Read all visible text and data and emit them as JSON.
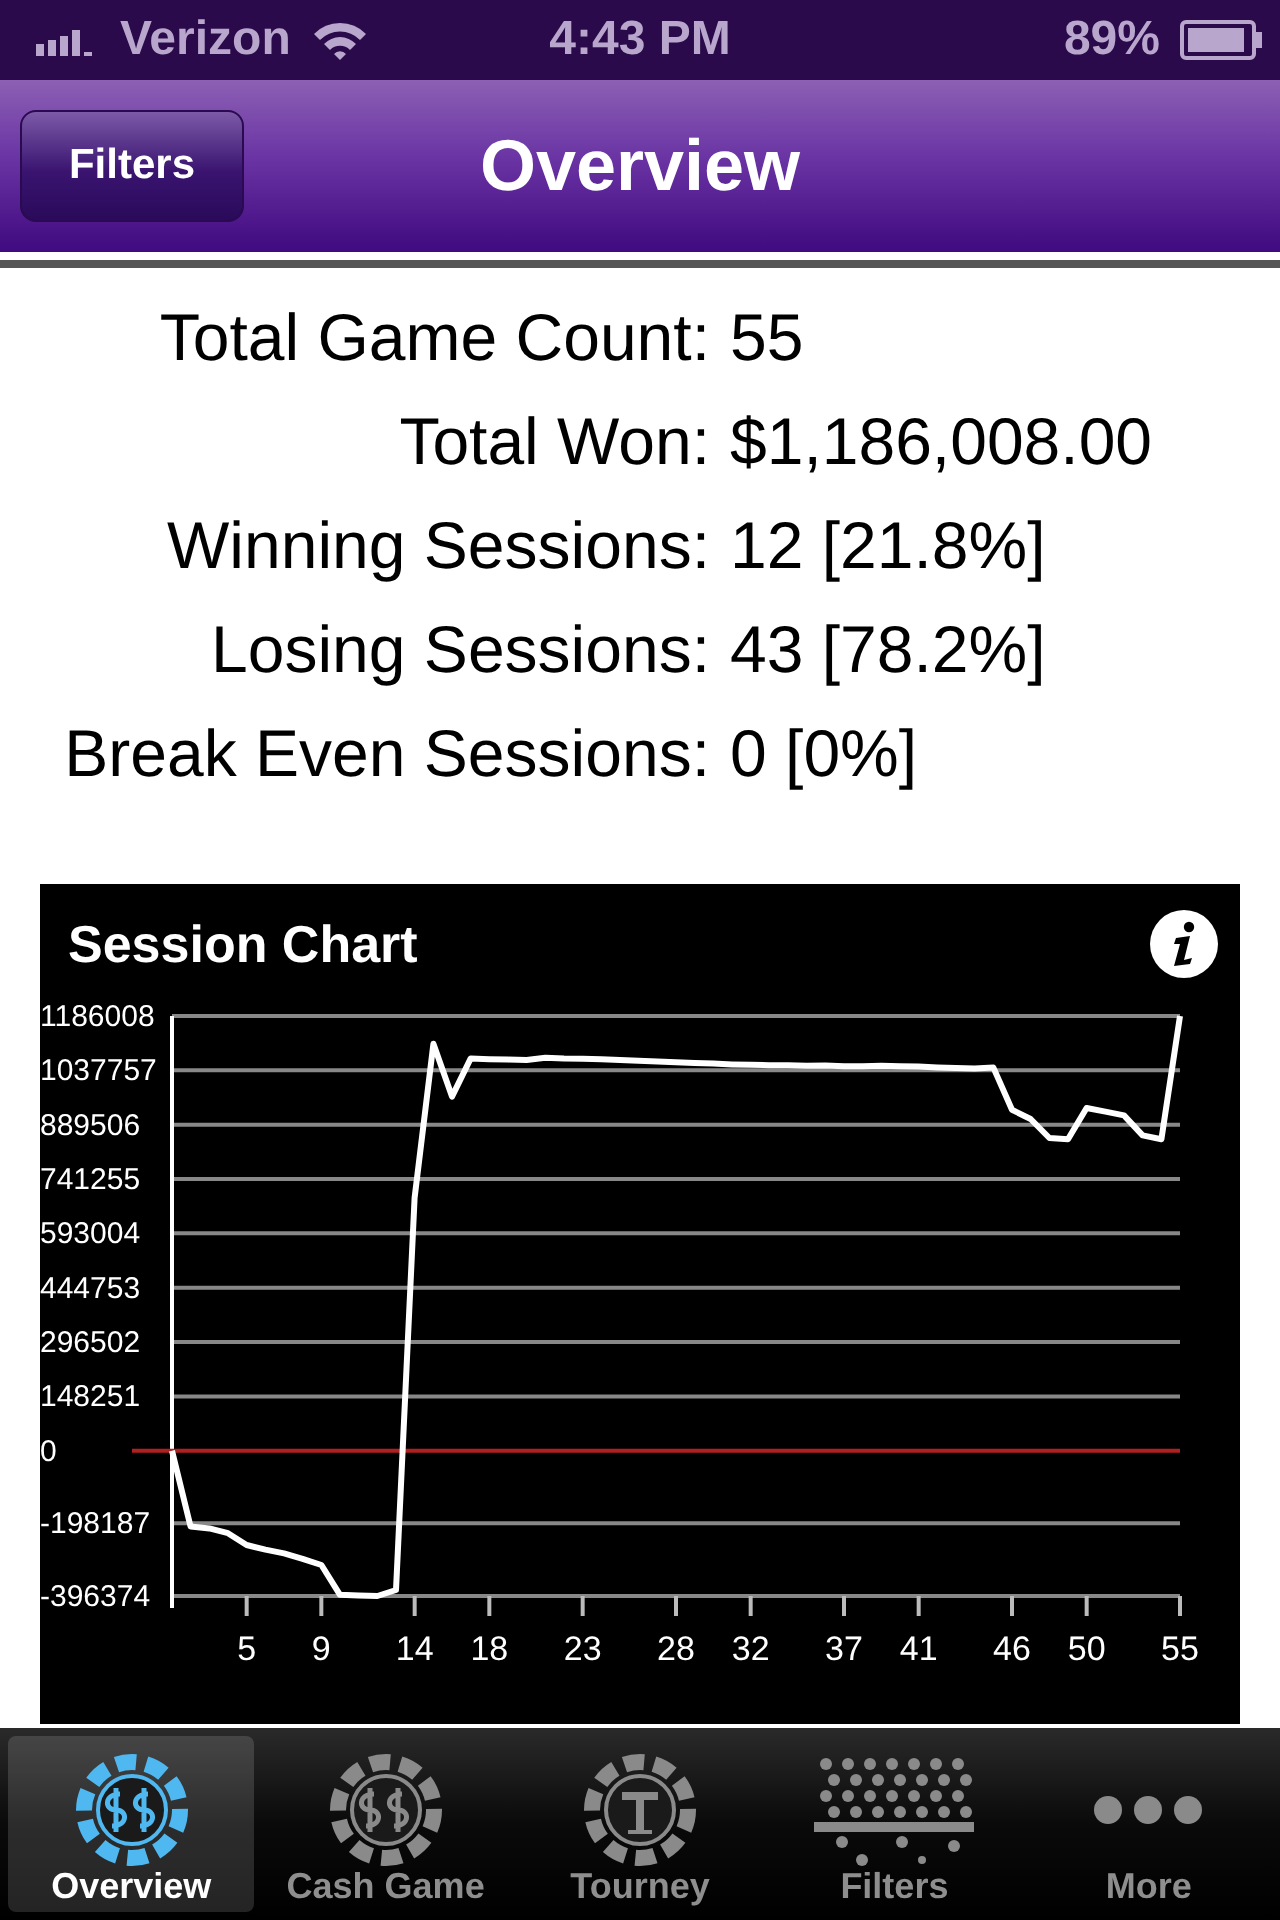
{
  "status_bar": {
    "carrier": "Verizon",
    "time": "4:43 PM",
    "battery": "89%"
  },
  "nav_bar": {
    "left_button": "Filters",
    "title": "Overview"
  },
  "stats": [
    {
      "label": "Total Game Count:",
      "value": "55"
    },
    {
      "label": "Total Won:",
      "value": "$1,186,008.00"
    },
    {
      "label": "Winning Sessions:",
      "value": "12 [21.8%]"
    },
    {
      "label": "Losing Sessions:",
      "value": "43 [78.2%]"
    },
    {
      "label": "Break Even Sessions:",
      "value": "0 [0%]"
    }
  ],
  "session_chart": {
    "chart_data": {
      "type": "line",
      "title": "Session Chart",
      "grid": true,
      "ref_lines": [
        {
          "axis": "y",
          "value": 0,
          "color": "#b02020"
        }
      ],
      "x": [
        1,
        2,
        3,
        4,
        5,
        6,
        7,
        8,
        9,
        10,
        11,
        12,
        13,
        14,
        15,
        16,
        17,
        18,
        19,
        20,
        21,
        22,
        23,
        24,
        25,
        26,
        27,
        28,
        29,
        30,
        31,
        32,
        33,
        34,
        35,
        36,
        37,
        38,
        39,
        40,
        41,
        42,
        43,
        44,
        45,
        46,
        47,
        48,
        49,
        50,
        51,
        52,
        53,
        54,
        55
      ],
      "series": [
        {
          "color": "#ffffff",
          "values": [
            0,
            -207000,
            -212000,
            -225000,
            -257000,
            -270000,
            -280000,
            -295000,
            -312000,
            -393000,
            -395000,
            -396374,
            -380000,
            690000,
            1110000,
            966000,
            1070000,
            1068000,
            1067000,
            1066000,
            1072000,
            1070000,
            1069000,
            1068000,
            1066000,
            1064000,
            1062000,
            1060000,
            1058000,
            1056000,
            1054000,
            1053000,
            1052000,
            1052000,
            1050000,
            1051000,
            1049000,
            1049000,
            1050000,
            1049000,
            1048000,
            1046000,
            1044000,
            1043000,
            1045000,
            930000,
            905000,
            853000,
            850000,
            935000,
            925000,
            915000,
            860000,
            850000,
            1186008
          ]
        }
      ],
      "xlim": [
        1,
        55
      ],
      "ylim": [
        -396374,
        1186008
      ],
      "xticks": [
        5,
        9,
        14,
        18,
        23,
        28,
        32,
        37,
        41,
        46,
        50,
        55
      ],
      "yticks": [
        1186008,
        1037757,
        889506,
        741255,
        593004,
        444753,
        296502,
        148251,
        0,
        -198187,
        -396374
      ]
    }
  },
  "tab_bar": [
    {
      "label": "Overview",
      "kind": "chip-ts",
      "selected": true
    },
    {
      "label": "Cash Game",
      "kind": "chip-dollar",
      "selected": false
    },
    {
      "label": "Tourney",
      "kind": "chip-t",
      "selected": false
    },
    {
      "label": "Filters",
      "kind": "dots",
      "selected": false
    },
    {
      "label": "More",
      "kind": "more",
      "selected": false
    }
  ]
}
